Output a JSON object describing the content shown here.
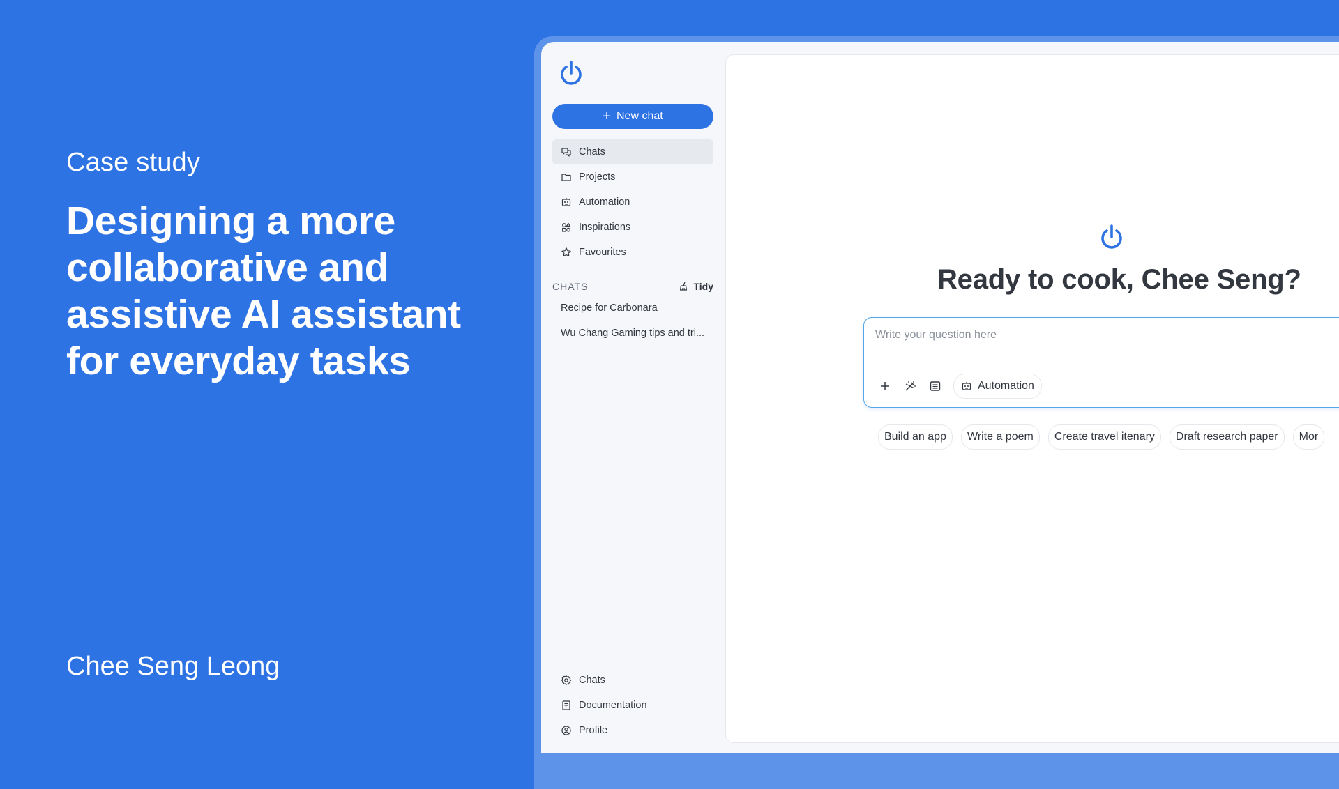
{
  "hero": {
    "eyebrow": "Case study",
    "title": "Designing a more collaborative and assistive AI assistant for everyday tasks",
    "author": "Chee Seng Leong"
  },
  "sidebar": {
    "new_chat_label": "New chat",
    "nav": [
      {
        "label": "Chats",
        "icon": "chat-bubbles-icon",
        "active": true
      },
      {
        "label": "Projects",
        "icon": "folder-icon",
        "active": false
      },
      {
        "label": "Automation",
        "icon": "robot-icon",
        "active": false
      },
      {
        "label": "Inspirations",
        "icon": "shapes-icon",
        "active": false
      },
      {
        "label": "Favourites",
        "icon": "star-icon",
        "active": false
      }
    ],
    "section_label": "CHATS",
    "tidy_label": "Tidy",
    "recent_chats": [
      "Recipe for Carbonara",
      "Wu Chang Gaming tips and tri..."
    ],
    "footer_nav": [
      {
        "label": "Chats",
        "icon": "settings-icon"
      },
      {
        "label": "Documentation",
        "icon": "document-icon"
      },
      {
        "label": "Profile",
        "icon": "user-circle-icon"
      }
    ]
  },
  "main": {
    "greeting": "Ready to cook, Chee Seng?",
    "input_placeholder": "Write your question here",
    "automation_chip": "Automation",
    "suggestions": [
      "Build an app",
      "Write a poem",
      "Create travel itenary",
      "Draft research paper",
      "Mor"
    ]
  },
  "colors": {
    "brand_blue": "#2E73E3",
    "input_border": "#55A8E8",
    "text_dark": "#333840"
  }
}
